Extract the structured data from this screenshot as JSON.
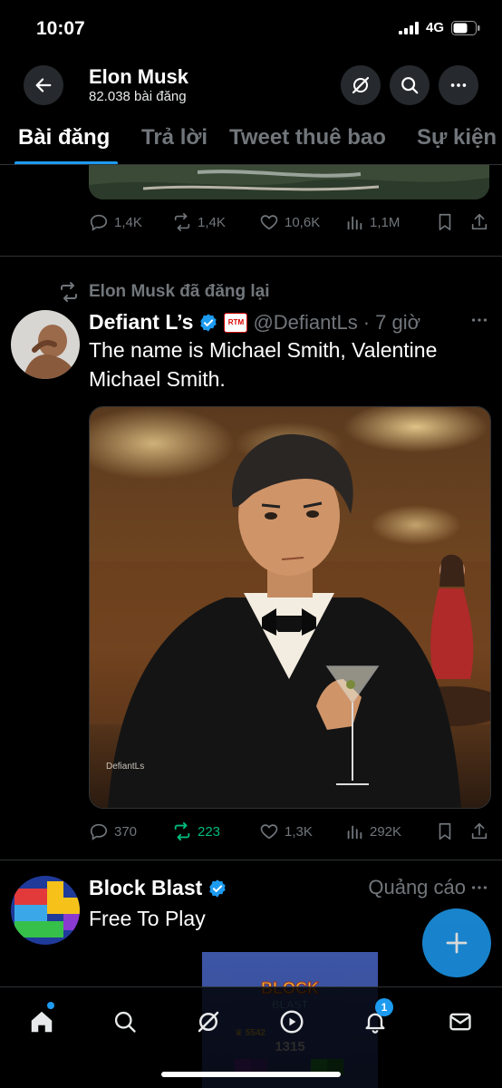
{
  "status_bar": {
    "time": "10:07",
    "network": "4G"
  },
  "header": {
    "name": "Elon Musk",
    "post_count": "82.038 bài đăng"
  },
  "tabs": [
    "Bài đăng",
    "Trả lời",
    "Tweet thuê bao",
    "Sự kiện"
  ],
  "prev_post": {
    "replies": "1,4K",
    "reposts": "1,4K",
    "likes": "10,6K",
    "views": "1,1M"
  },
  "repost": {
    "reposted_by": "Elon Musk đã đăng lại",
    "author": "Defiant L’s",
    "badge": "RTM",
    "handle": "@DefiantLs",
    "time": "· 7 giờ",
    "text": "The name is Michael Smith, Valentine Michael Smith.",
    "image_watermark": "DefiantLs",
    "replies": "370",
    "reposts": "223",
    "likes": "1,3K",
    "views": "292K"
  },
  "ad": {
    "author": "Block Blast",
    "label": "Quảng cáo",
    "text": "Free To Play",
    "game_score": "1315",
    "game_best": "5542"
  },
  "nav": {
    "notification_count": "1"
  },
  "colors": {
    "accent": "#1d9bf0",
    "repost_active": "#00ba7c",
    "muted": "#71767b"
  }
}
